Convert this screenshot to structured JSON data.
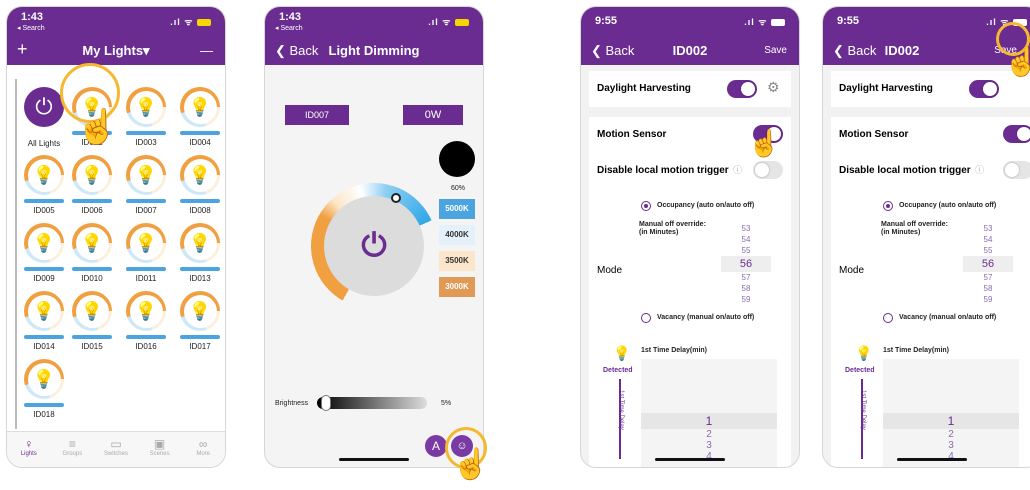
{
  "phone1": {
    "status_time": "1:43",
    "status_sub": "◂ Search",
    "nav_left": "+",
    "nav_title": "My Lights▾",
    "nav_right": "—",
    "all_label": "All Lights",
    "lights": [
      "ID002",
      "ID003",
      "ID004",
      "ID005",
      "ID006",
      "ID007",
      "ID008",
      "ID009",
      "ID010",
      "ID011",
      "ID013",
      "ID014",
      "ID015",
      "ID016",
      "ID017",
      "ID018"
    ],
    "tabs": [
      "Lights",
      "Groups",
      "Switches",
      "Scenes",
      "More"
    ]
  },
  "phone2": {
    "status_time": "1:43",
    "status_sub": "◂ Search",
    "back": "❮ Back",
    "title": "Light Dimming",
    "device": "ID007",
    "power": "0W",
    "percent": "60%",
    "temps": [
      "5000K",
      "4000K",
      "3500K",
      "3000K"
    ],
    "brightness_label": "Brightness",
    "brightness_value": "5%",
    "a_label": "A"
  },
  "phone3": {
    "status_time": "9:55",
    "back": "❮ Back",
    "title": "ID002",
    "save": "Save",
    "daylight": "Daylight Harvesting",
    "motion": "Motion Sensor",
    "disable": "Disable local motion trigger",
    "occupancy": "Occupancy (auto on/auto off)",
    "manual_off": "Manual off override:",
    "in_minutes": "(in Minutes)",
    "mode": "Mode",
    "picker": [
      "53",
      "54",
      "55",
      "56",
      "57",
      "58",
      "59"
    ],
    "vacancy": "Vacancy (manual on/auto off)",
    "delay": "1st Time Delay(min)",
    "detected": "Detected",
    "vertical": "1st Time Delay",
    "delay_picker": [
      "1",
      "2",
      "3",
      "4"
    ]
  },
  "colors": {
    "accent": "#6a2c91",
    "ring": "#f5b82e",
    "blue": "#4ba4e0"
  }
}
